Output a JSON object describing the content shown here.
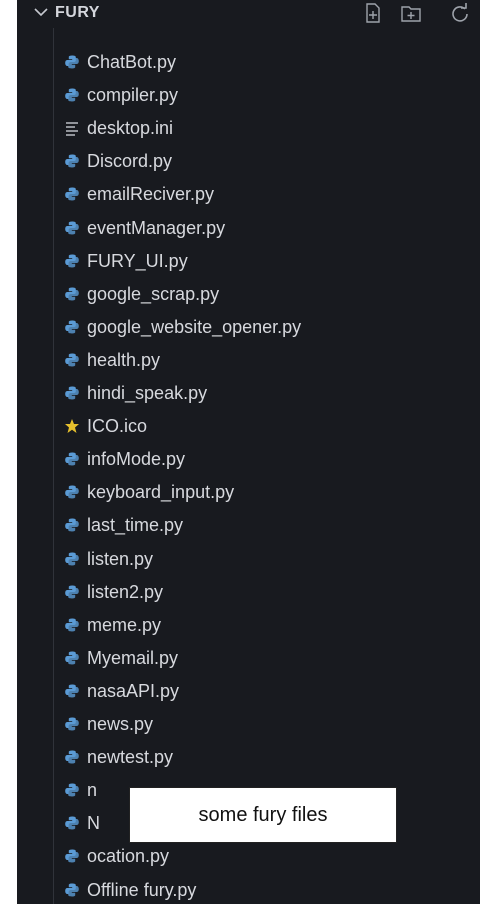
{
  "explorer": {
    "folder_name": "FURY",
    "actions": [
      "new-file-icon",
      "new-folder-icon",
      "refresh-icon"
    ],
    "files": [
      {
        "name": "ChatBot.py",
        "icon": "python-icon"
      },
      {
        "name": "compiler.py",
        "icon": "python-icon"
      },
      {
        "name": "desktop.ini",
        "icon": "settings-lines-icon"
      },
      {
        "name": "Discord.py",
        "icon": "python-icon"
      },
      {
        "name": "emailReciver.py",
        "icon": "python-icon"
      },
      {
        "name": "eventManager.py",
        "icon": "python-icon"
      },
      {
        "name": "FURY_UI.py",
        "icon": "python-icon"
      },
      {
        "name": "google_scrap.py",
        "icon": "python-icon"
      },
      {
        "name": "google_website_opener.py",
        "icon": "python-icon"
      },
      {
        "name": "health.py",
        "icon": "python-icon"
      },
      {
        "name": "hindi_speak.py",
        "icon": "python-icon"
      },
      {
        "name": "ICO.ico",
        "icon": "star-icon"
      },
      {
        "name": "infoMode.py",
        "icon": "python-icon"
      },
      {
        "name": "keyboard_input.py",
        "icon": "python-icon"
      },
      {
        "name": "last_time.py",
        "icon": "python-icon"
      },
      {
        "name": "listen.py",
        "icon": "python-icon"
      },
      {
        "name": "listen2.py",
        "icon": "python-icon"
      },
      {
        "name": "meme.py",
        "icon": "python-icon"
      },
      {
        "name": "Myemail.py",
        "icon": "python-icon"
      },
      {
        "name": "nasaAPI.py",
        "icon": "python-icon"
      },
      {
        "name": "news.py",
        "icon": "python-icon"
      },
      {
        "name": "newtest.py",
        "icon": "python-icon"
      },
      {
        "name": "n",
        "icon": "python-icon"
      },
      {
        "name": "N",
        "icon": "python-icon"
      },
      {
        "name": "ocation.py",
        "icon": "python-icon"
      },
      {
        "name": "Offline fury.py",
        "icon": "python-icon"
      }
    ]
  },
  "caption": "some fury files",
  "colors": {
    "panel_bg": "#181a1f",
    "python_icon": "#5b9bd5",
    "star_icon": "#e6c02d",
    "text": "#d7d9de"
  }
}
